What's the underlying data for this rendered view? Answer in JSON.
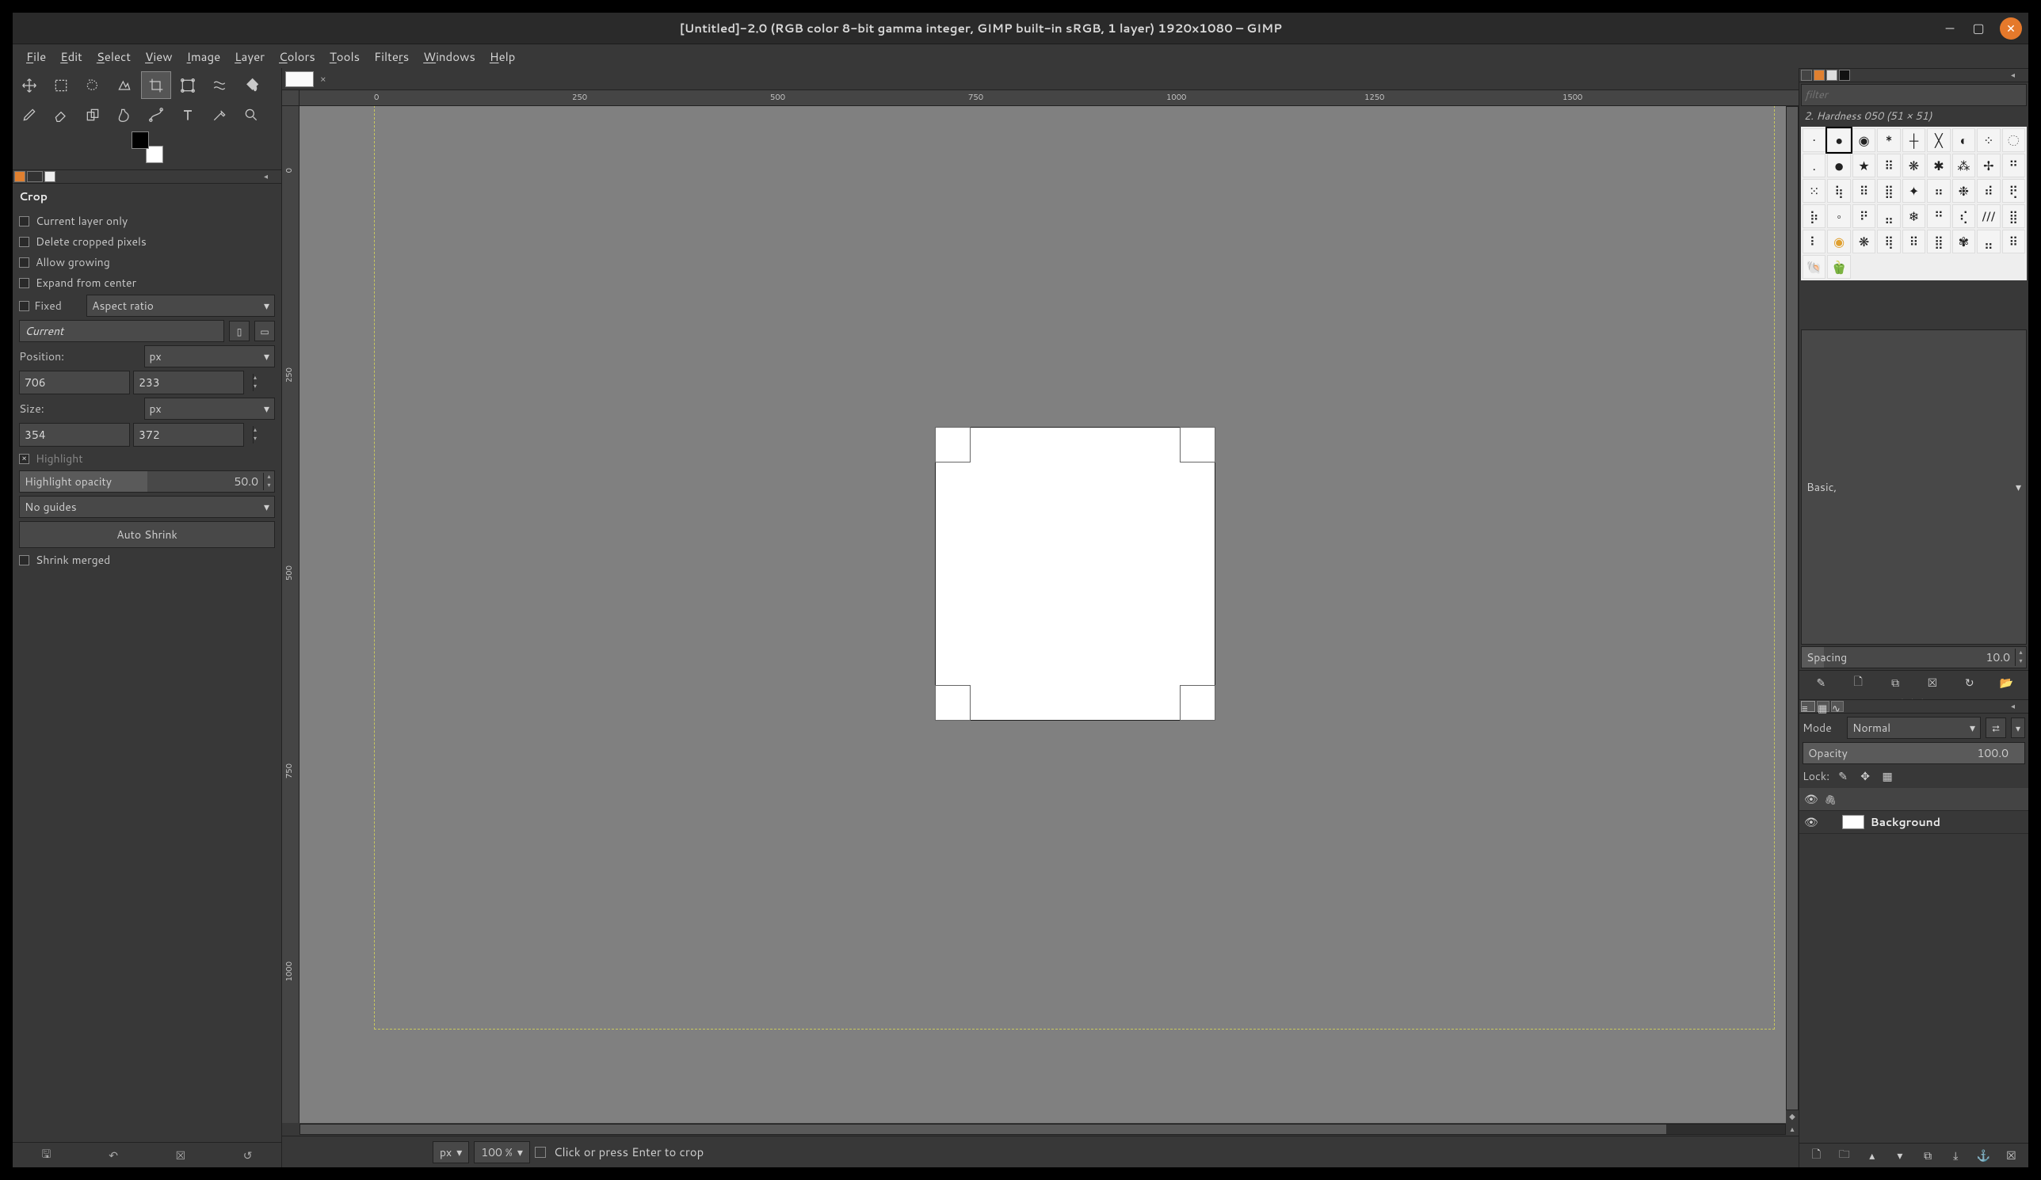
{
  "window": {
    "title": "[Untitled]-2.0 (RGB color 8-bit gamma integer, GIMP built-in sRGB, 1 layer) 1920x1080 – GIMP"
  },
  "menu": {
    "items": [
      "File",
      "Edit",
      "Select",
      "View",
      "Image",
      "Layer",
      "Colors",
      "Tools",
      "Filters",
      "Windows",
      "Help"
    ]
  },
  "tool_options": {
    "title": "Crop",
    "current_layer_only": "Current layer only",
    "delete_cropped": "Delete cropped pixels",
    "allow_growing": "Allow growing",
    "expand_from_center": "Expand from center",
    "fixed_label": "Fixed",
    "fixed_mode": "Aspect ratio",
    "current_value": "Current",
    "position_label": "Position:",
    "position_unit": "px",
    "pos_x": "706",
    "pos_y": "233",
    "size_label": "Size:",
    "size_unit": "px",
    "size_w": "354",
    "size_h": "372",
    "highlight_label": "Highlight",
    "highlight_checked": true,
    "highlight_opacity_label": "Highlight opacity",
    "highlight_opacity_value": "50.0",
    "guides": "No guides",
    "auto_shrink": "Auto Shrink",
    "shrink_merged": "Shrink merged"
  },
  "status": {
    "unit": "px",
    "zoom": "100 %",
    "message": "Click or press Enter to crop"
  },
  "brushes": {
    "filter_placeholder": "filter",
    "selected_name": "2. Hardness 050 (51 × 51)",
    "preset": "Basic,",
    "spacing_label": "Spacing",
    "spacing_value": "10.0"
  },
  "layers": {
    "mode_label": "Mode",
    "mode_value": "Normal",
    "opacity_label": "Opacity",
    "opacity_value": "100.0",
    "lock_label": "Lock:",
    "layer_name": "Background"
  },
  "ruler_h_ticks": [
    "0",
    "250",
    "500",
    "750",
    "1000",
    "1250",
    "1500"
  ],
  "ruler_v_ticks": [
    "0",
    "250",
    "500",
    "750",
    "1000"
  ]
}
